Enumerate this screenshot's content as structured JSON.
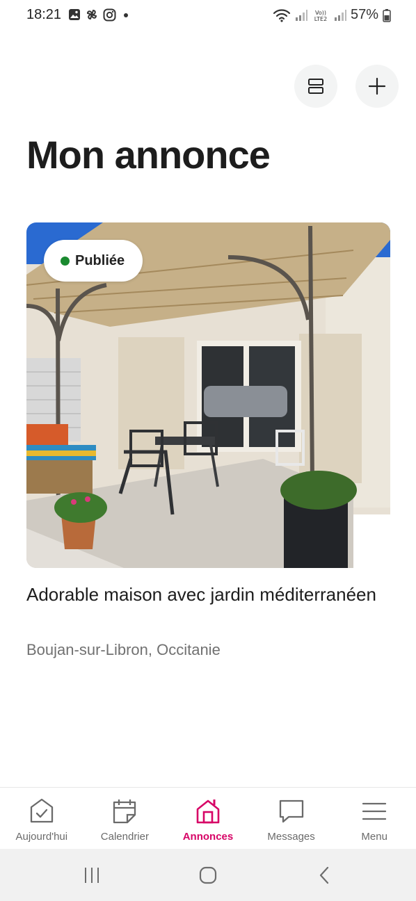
{
  "status_bar": {
    "time": "18:21",
    "battery": "57%",
    "icons_left": [
      "gallery-icon",
      "pinwheel-icon",
      "instagram-icon",
      "dot-icon"
    ],
    "icons_right": [
      "wifi-icon",
      "signal-icon",
      "volte-icon",
      "signal-icon",
      "battery-icon"
    ]
  },
  "header": {
    "actions": [
      {
        "icon": "view-toggle-icon"
      },
      {
        "icon": "plus-icon"
      }
    ],
    "title": "Mon annonce"
  },
  "listing": {
    "status": "Publiée",
    "status_color": "#1a8a2f",
    "title": "Adorable maison avec jardin méditerranéen",
    "location": "Boujan-sur-Libron, Occitanie"
  },
  "bottom_nav": {
    "active_color": "#d70466",
    "items": [
      {
        "label": "Aujourd'hui",
        "icon": "today-check-icon",
        "active": false
      },
      {
        "label": "Calendrier",
        "icon": "calendar-icon",
        "active": false
      },
      {
        "label": "Annonces",
        "icon": "house-icon",
        "active": true
      },
      {
        "label": "Messages",
        "icon": "message-icon",
        "active": false
      },
      {
        "label": "Menu",
        "icon": "menu-icon",
        "active": false
      }
    ]
  },
  "system_nav": [
    "recents-button",
    "home-button",
    "back-button"
  ]
}
